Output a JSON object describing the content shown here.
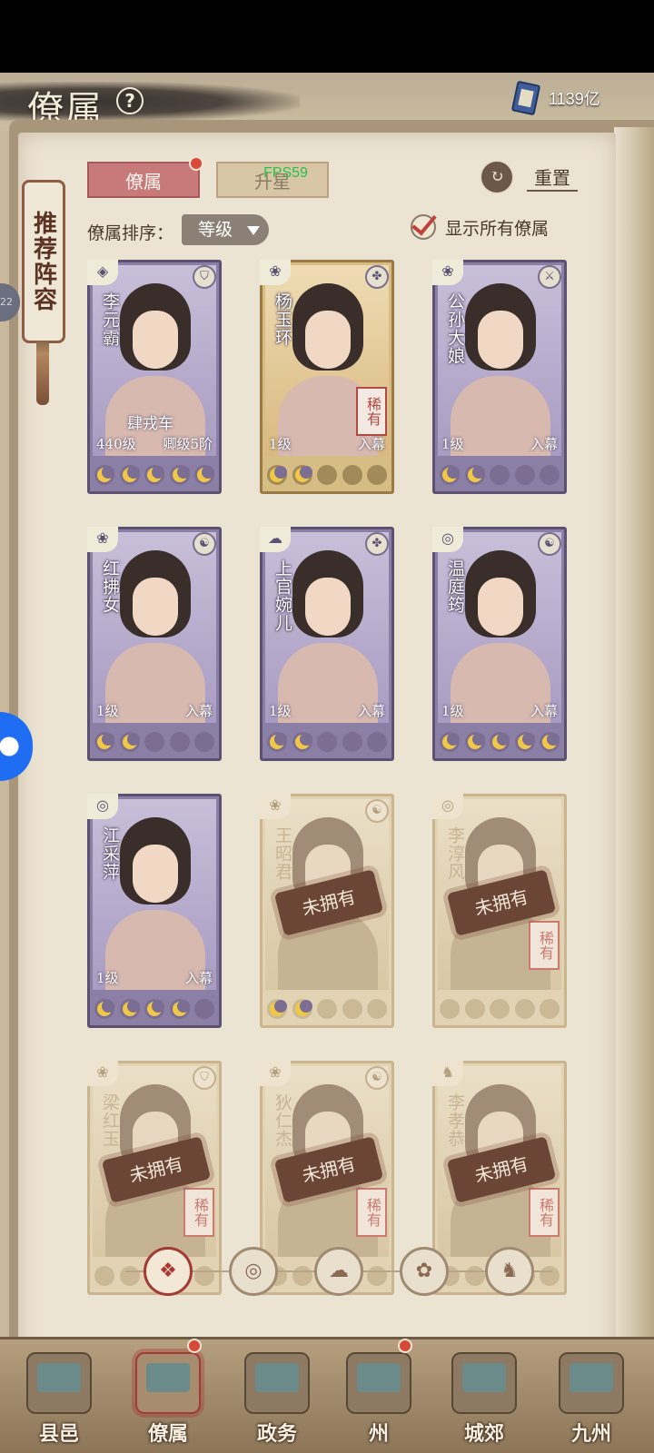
{
  "header": {
    "title": "僚属",
    "help_label": "?",
    "currency_value": "1139亿"
  },
  "side_tab": {
    "label": "推荐阵容",
    "edge_badge": "22"
  },
  "tabs": [
    {
      "label": "僚属"
    },
    {
      "label": "升星"
    }
  ],
  "fps_text": "FPS59",
  "reset": {
    "label": "重置",
    "icon": "reset-icon"
  },
  "sort": {
    "label": "僚属排序：",
    "selected": "等级"
  },
  "show_all": {
    "label": "显示所有僚属",
    "checked": true
  },
  "cards": [
    {
      "name": "李元霸",
      "level": "440级",
      "status": "卿级5阶",
      "subtitle": "肆戎车",
      "stars_on": 5,
      "owned": true,
      "rare": "",
      "class_icon": "shield",
      "type_icon": "shield-icon"
    },
    {
      "name": "杨玉环",
      "level": "1级",
      "status": "入幕",
      "subtitle": "",
      "stars_on": 2,
      "owned": true,
      "rare": "稀有",
      "class_icon": "fan",
      "type_icon": "emblem-icon"
    },
    {
      "name": "公孙大娘",
      "level": "1级",
      "status": "入幕",
      "subtitle": "",
      "stars_on": 2,
      "owned": true,
      "rare": "",
      "class_icon": "fan",
      "type_icon": "sword-icon"
    },
    {
      "name": "红拂女",
      "level": "1级",
      "status": "入幕",
      "subtitle": "",
      "stars_on": 2,
      "owned": true,
      "rare": "",
      "class_icon": "fan",
      "type_icon": "yinyang-icon"
    },
    {
      "name": "上官婉儿",
      "level": "1级",
      "status": "入幕",
      "subtitle": "",
      "stars_on": 2,
      "owned": true,
      "rare": "",
      "class_icon": "cloud",
      "type_icon": "emblem-icon"
    },
    {
      "name": "温庭筠",
      "level": "1级",
      "status": "入幕",
      "subtitle": "",
      "stars_on": 5,
      "owned": true,
      "rare": "",
      "class_icon": "bell",
      "type_icon": "yinyang-icon"
    },
    {
      "name": "江采萍",
      "level": "1级",
      "status": "入幕",
      "subtitle": "",
      "stars_on": 4,
      "owned": true,
      "rare": "",
      "class_icon": "bell",
      "type_icon": ""
    },
    {
      "name": "王昭君",
      "level": "",
      "status": "",
      "subtitle": "",
      "stars_on": 2,
      "owned": false,
      "rare": "",
      "class_icon": "fan",
      "type_icon": "yinyang-icon",
      "locked_label": "未拥有"
    },
    {
      "name": "李淳风",
      "level": "",
      "status": "",
      "subtitle": "",
      "stars_on": 0,
      "owned": false,
      "rare": "稀有",
      "class_icon": "bell",
      "type_icon": "",
      "locked_label": "未拥有"
    },
    {
      "name": "梁红玉",
      "level": "",
      "status": "",
      "subtitle": "",
      "stars_on": 0,
      "owned": false,
      "rare": "稀有",
      "class_icon": "fan",
      "type_icon": "shield-icon",
      "locked_label": "未拥有"
    },
    {
      "name": "狄仁杰",
      "level": "",
      "status": "",
      "subtitle": "",
      "stars_on": 0,
      "owned": false,
      "rare": "稀有",
      "class_icon": "fan",
      "type_icon": "yinyang-icon",
      "locked_label": "未拥有"
    },
    {
      "name": "李孝恭",
      "level": "",
      "status": "",
      "subtitle": "",
      "stars_on": 0,
      "owned": false,
      "rare": "稀有",
      "class_icon": "cat",
      "type_icon": "",
      "locked_label": "未拥有"
    }
  ],
  "pager": [
    {
      "icon": "all-filter-icon",
      "glyph": "❖",
      "active": true
    },
    {
      "icon": "bell-filter-icon",
      "glyph": "◎",
      "active": false
    },
    {
      "icon": "cloud-filter-icon",
      "glyph": "☁",
      "active": false
    },
    {
      "icon": "fan-filter-icon",
      "glyph": "✿",
      "active": false
    },
    {
      "icon": "beast-filter-icon",
      "glyph": "♞",
      "active": false
    }
  ],
  "bottom_nav": [
    {
      "label": "县邑",
      "active": false
    },
    {
      "label": "僚属",
      "active": true
    },
    {
      "label": "政务",
      "active": false
    },
    {
      "label": "州",
      "active": false
    },
    {
      "label": "城郊",
      "active": false
    },
    {
      "label": "九州",
      "active": false
    }
  ]
}
